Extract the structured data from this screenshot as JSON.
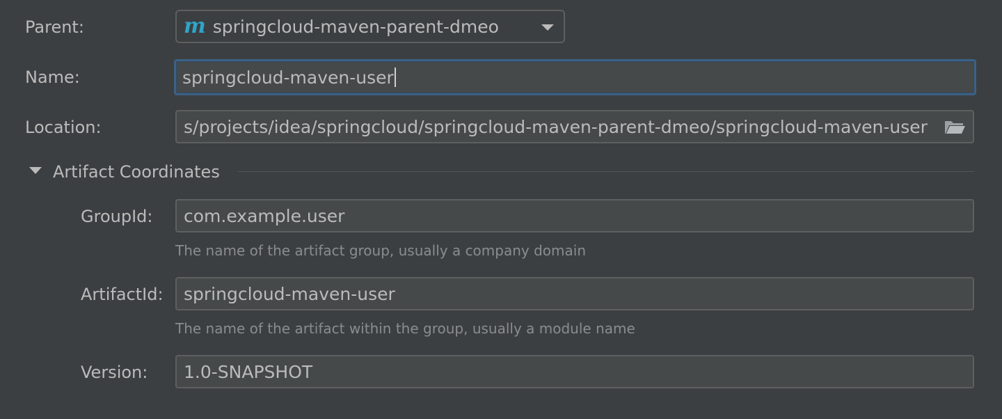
{
  "parent": {
    "label": "Parent:",
    "icon": "maven-m-icon",
    "icon_glyph": "m",
    "value": "springcloud-maven-parent-dmeo"
  },
  "name": {
    "label": "Name:",
    "value": "springcloud-maven-user"
  },
  "location": {
    "label": "Location:",
    "value": "s/projects/idea/springcloud/springcloud-maven-parent-dmeo/springcloud-maven-user",
    "icon": "folder-icon"
  },
  "artifact": {
    "title": "Artifact Coordinates",
    "group_id": {
      "label": "GroupId:",
      "value": "com.example.user",
      "hint": "The name of the artifact group, usually a company domain"
    },
    "artifact_id": {
      "label": "ArtifactId:",
      "value": "springcloud-maven-user",
      "hint": "The name of the artifact within the group, usually a module name"
    },
    "version": {
      "label": "Version:",
      "value": "1.0-SNAPSHOT"
    }
  },
  "colors": {
    "background": "#3c3f41",
    "field": "#45494a",
    "focus_border": "#3d6185",
    "maven_icon": "#2fa5c9"
  }
}
